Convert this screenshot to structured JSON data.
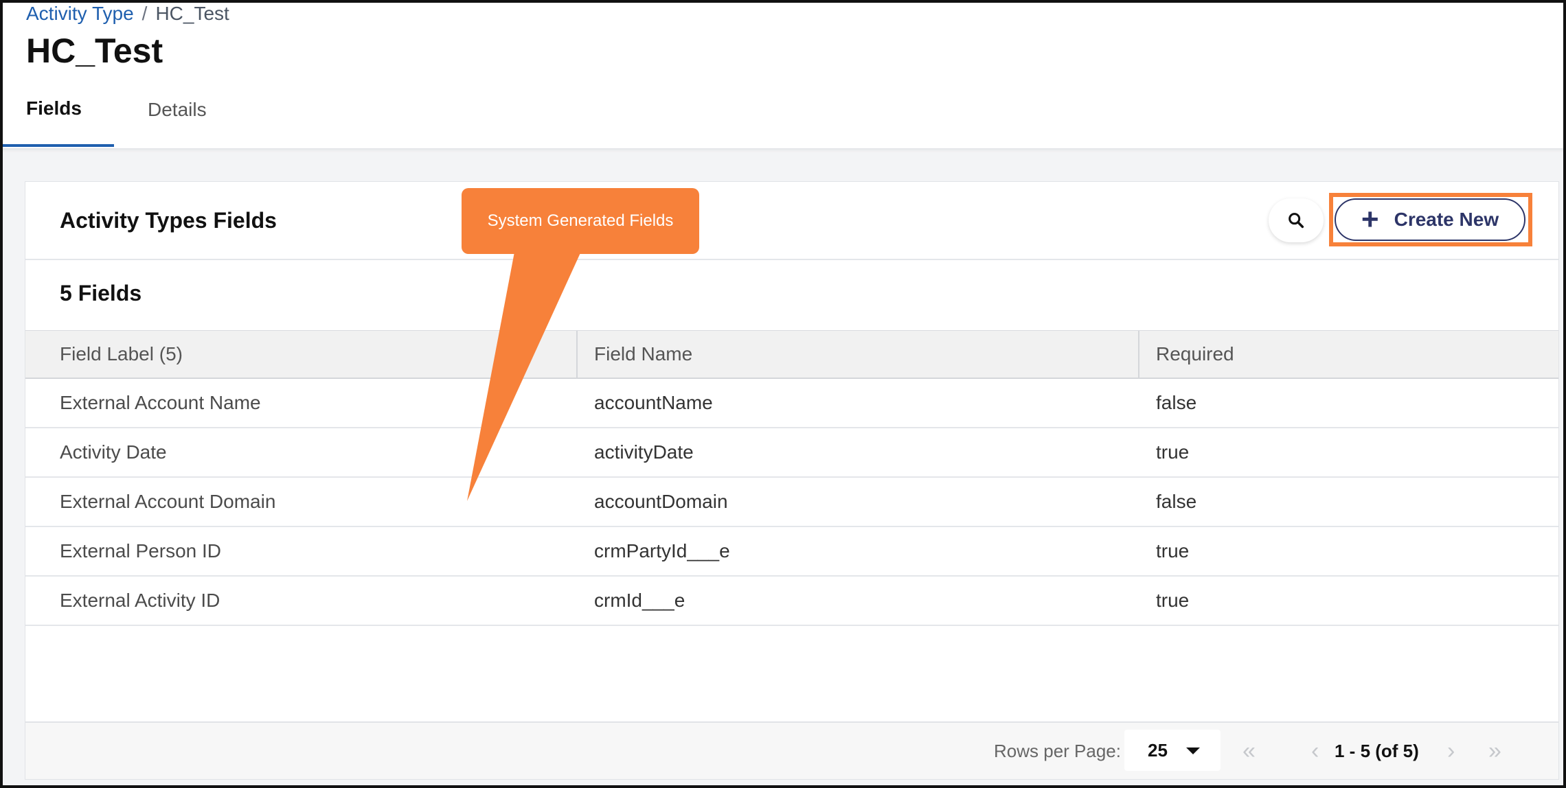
{
  "breadcrumb": {
    "parent": "Activity Type",
    "separator": "/",
    "current": "HC_Test"
  },
  "page_title": "HC_Test",
  "tabs": [
    {
      "label": "Fields",
      "active": true
    },
    {
      "label": "Details",
      "active": false
    }
  ],
  "card": {
    "title": "Activity Types Fields",
    "count_label": "5 Fields",
    "search_icon": "search-icon",
    "create_button": {
      "plus": "+",
      "label": "Create New"
    }
  },
  "callout": {
    "text": "System Generated Fields",
    "color": "#f7813a"
  },
  "table": {
    "headers": [
      "Field Label (5)",
      "Field Name",
      "Required"
    ],
    "rows": [
      [
        "External Account Name",
        "accountName",
        "false"
      ],
      [
        "Activity Date",
        "activityDate",
        "true"
      ],
      [
        "External Account Domain",
        "accountDomain",
        "false"
      ],
      [
        "External Person ID",
        "crmPartyId___e",
        "true"
      ],
      [
        "External Activity ID",
        "crmId___e",
        "true"
      ]
    ]
  },
  "footer": {
    "rows_per_page_label": "Rows per Page:",
    "rows_per_page_value": "25",
    "page_info": "1 - 5 (of 5)",
    "first_icon": "«",
    "prev_icon": "‹",
    "next_icon": "›",
    "last_icon": "»"
  },
  "colors": {
    "accent": "#1f5fae",
    "highlight": "#f7813a",
    "button": "#2d3568"
  }
}
